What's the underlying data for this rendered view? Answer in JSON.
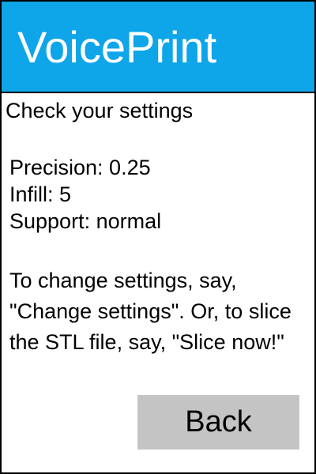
{
  "app": {
    "title": "VoicePrint"
  },
  "content": {
    "heading": "Check your settings",
    "settings": [
      "Precision: 0.25",
      "Infill: 5",
      "Support: normal"
    ],
    "instructions": "To change settings, say, \"Change settings\". Or, to slice the STL file, say, \"Slice now!\""
  },
  "actions": {
    "back_label": "Back"
  },
  "colors": {
    "header_background": "#0ea5e9",
    "header_text": "#ffffff",
    "button_background": "#c4c4c4",
    "border": "#000000"
  }
}
